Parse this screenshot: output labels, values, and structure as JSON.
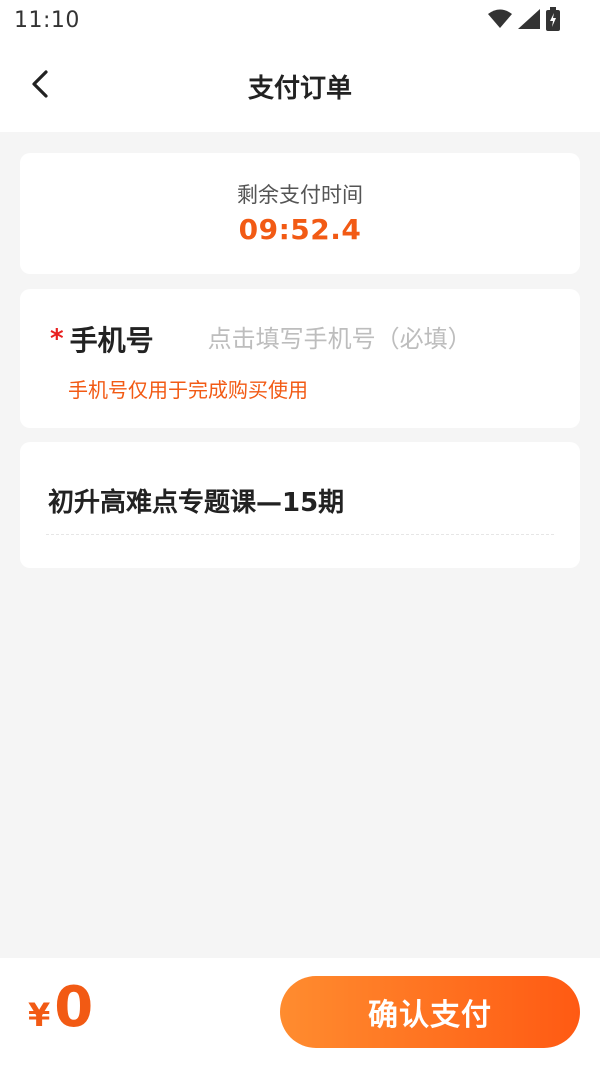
{
  "status_bar": {
    "time": "11:10",
    "icons": [
      "wifi-icon",
      "signal-icon",
      "battery-icon"
    ]
  },
  "nav": {
    "back_icon": "chevron-left-icon",
    "title": "支付订单"
  },
  "timer": {
    "label": "剩余支付时间",
    "value": "09:52.4"
  },
  "phone": {
    "required_mark": "*",
    "label": "手机号",
    "value": "",
    "placeholder": "点击填写手机号（必填）",
    "hint": "手机号仅用于完成购买使用"
  },
  "course": {
    "title": "初升高难点专题课—15期"
  },
  "footer": {
    "currency": "¥",
    "amount": "0",
    "pay_label": "确认支付"
  },
  "colors": {
    "accent": "#f25a14",
    "required": "#e8201f",
    "button_gradient_start": "#ff8c2f",
    "button_gradient_end": "#ff5a13",
    "background": "#f5f5f5"
  }
}
